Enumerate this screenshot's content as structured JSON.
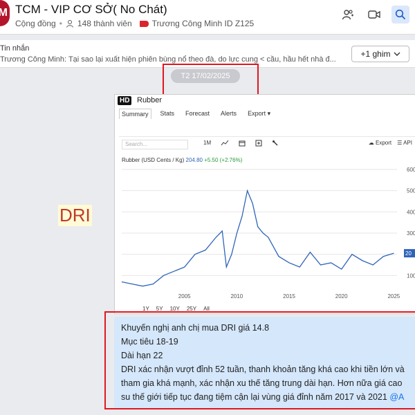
{
  "header": {
    "logo_letter": "M",
    "title": "TCM - VIP CƠ SỞ( No Chát)",
    "community_label": "Cộng đồng",
    "members": "148 thành viên",
    "owner_tag": "Trương Công Minh ID Z125"
  },
  "pinned": {
    "label": "Tin nhắn",
    "text": "Trương Công Minh: Tại sao lại xuất hiện phiên bùng nổ theo đà, do lực cung < cầu, hầu hết nhà đ...",
    "pin_button": "+1 ghim"
  },
  "date_chip": "T2 17/02/2025",
  "side_text": "DRI",
  "image": {
    "hd_badge": "HD",
    "title": "Rubber",
    "tabs": [
      "Summary",
      "Stats",
      "Forecast",
      "Alerts",
      "Export ▾"
    ],
    "search_placeholder": "Search...",
    "range_btn": "1M",
    "export_label": "Export",
    "api_label": "API",
    "legend_name": "Rubber (USD Cents / Kg)",
    "legend_value": "204.80",
    "legend_change": "+5.50 (+2.76%)",
    "range_options": [
      "1Y",
      "5Y",
      "10Y",
      "25Y",
      "All"
    ]
  },
  "chart_data": {
    "type": "line",
    "title": "Rubber (USD Cents / Kg)",
    "x": [
      1999,
      2000,
      2001,
      2002,
      2003,
      2004,
      2005,
      2006,
      2007,
      2008,
      2008.6,
      2009,
      2009.5,
      2010,
      2010.5,
      2011,
      2011.5,
      2012,
      2012.5,
      2013,
      2014,
      2015,
      2016,
      2017,
      2018,
      2019,
      2020,
      2021,
      2022,
      2023,
      2024,
      2025
    ],
    "series": [
      {
        "values": [
          70,
          60,
          50,
          60,
          100,
          120,
          140,
          200,
          220,
          280,
          310,
          140,
          200,
          300,
          380,
          500,
          440,
          330,
          300,
          280,
          190,
          160,
          140,
          210,
          150,
          160,
          130,
          200,
          170,
          150,
          190,
          205
        ]
      }
    ],
    "ylabel": "",
    "xticks": [
      "2005",
      "2010",
      "2015",
      "2020",
      "2025"
    ],
    "yticks": [
      "100",
      "200",
      "300",
      "400",
      "500",
      "600"
    ],
    "ylim": [
      0,
      600
    ],
    "last_value_label": "20",
    "grid": true,
    "line_color": "#2f64b8"
  },
  "message": {
    "lines": [
      "Khuyến nghị anh chị mua DRI giá 14.8",
      "Mục tiêu 18-19",
      "Dài hạn 22",
      "DRI xác nhận vượt đỉnh 52 tuần, thanh khoản tăng khá cao khi tiền lớn và",
      "tham gia khá mạnh, xác nhận xu thế tăng trung dài hạn. Hơn nữa giá cao",
      "su thế giới tiếp tục đang tiệm cận lại vùng giá đỉnh năm 2017 và 2021"
    ],
    "mention": "@A"
  },
  "colors": {
    "accent": "#1a73e8",
    "highlight_box": "#e0161f",
    "message_bg": "#d4e7fb",
    "logo_bg": "#b3162c"
  }
}
